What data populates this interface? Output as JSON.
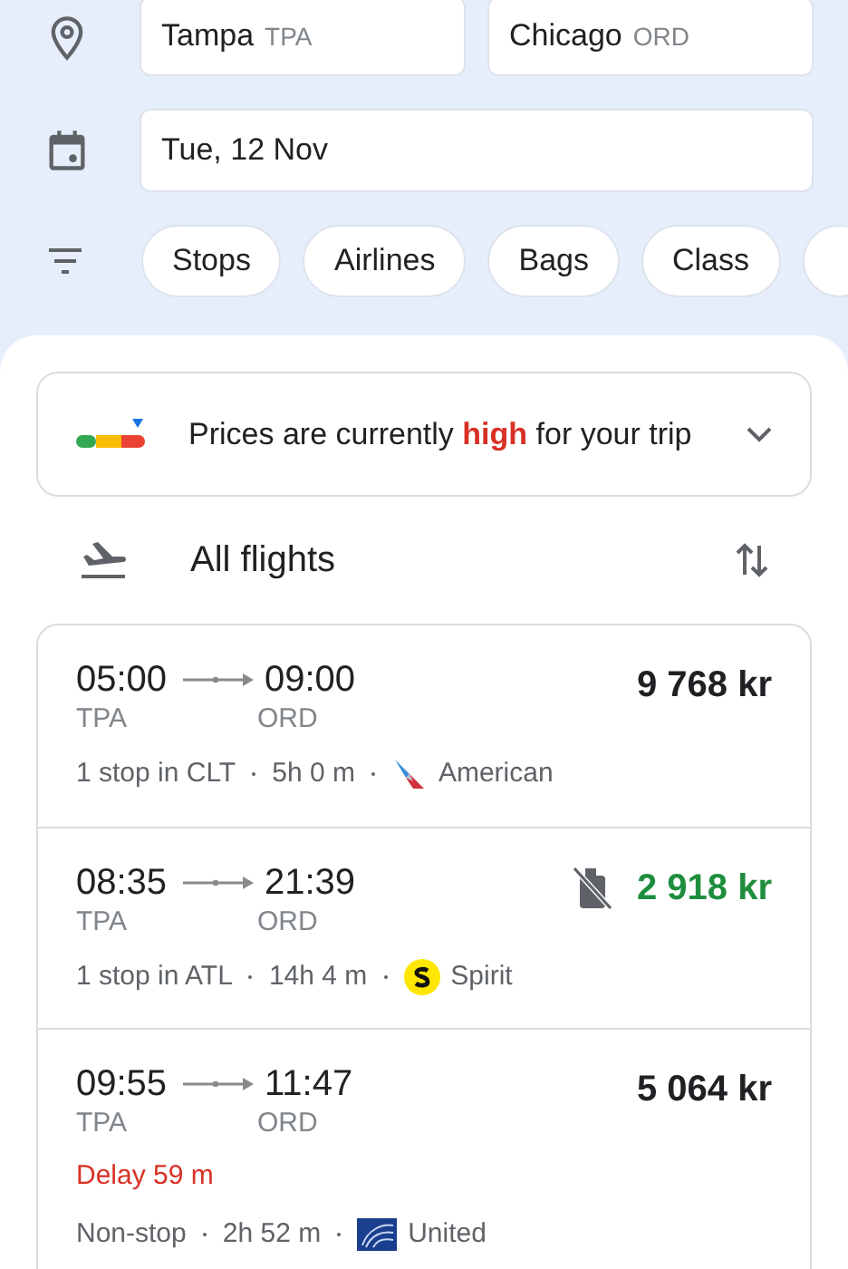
{
  "search": {
    "origin": {
      "city": "Tampa",
      "code": "TPA"
    },
    "destination": {
      "city": "Chicago",
      "code": "ORD"
    },
    "date": "Tue, 12 Nov"
  },
  "filters": [
    {
      "label": "Stops"
    },
    {
      "label": "Airlines"
    },
    {
      "label": "Bags"
    },
    {
      "label": "Class"
    }
  ],
  "price_insight": {
    "text": "Prices are currently **high** for your trip",
    "expanded": false
  },
  "section": {
    "title": "All flights"
  },
  "flights": [
    {
      "depart": "05:00",
      "arrive": "09:00",
      "from": "TPA",
      "to": "ORD",
      "price": "9 768 kr",
      "cheapest": false,
      "no_carry_on": false,
      "stops": "1 stop in CLT",
      "duration": "5h 0 m",
      "airline": "American"
    },
    {
      "depart": "08:35",
      "arrive": "21:39",
      "from": "TPA",
      "to": "ORD",
      "price": "2 918 kr",
      "cheapest": true,
      "no_carry_on": true,
      "stops": "1 stop in ATL",
      "duration": "14h 4 m",
      "airline": "Spirit"
    },
    {
      "depart": "09:55",
      "arrive": "11:47",
      "from": "TPA",
      "to": "ORD",
      "price": "5 064 kr",
      "cheapest": false,
      "no_carry_on": false,
      "delay": "Delay 59 m",
      "stops": "Non-stop",
      "duration": "2h 52 m",
      "airline": "United"
    }
  ]
}
